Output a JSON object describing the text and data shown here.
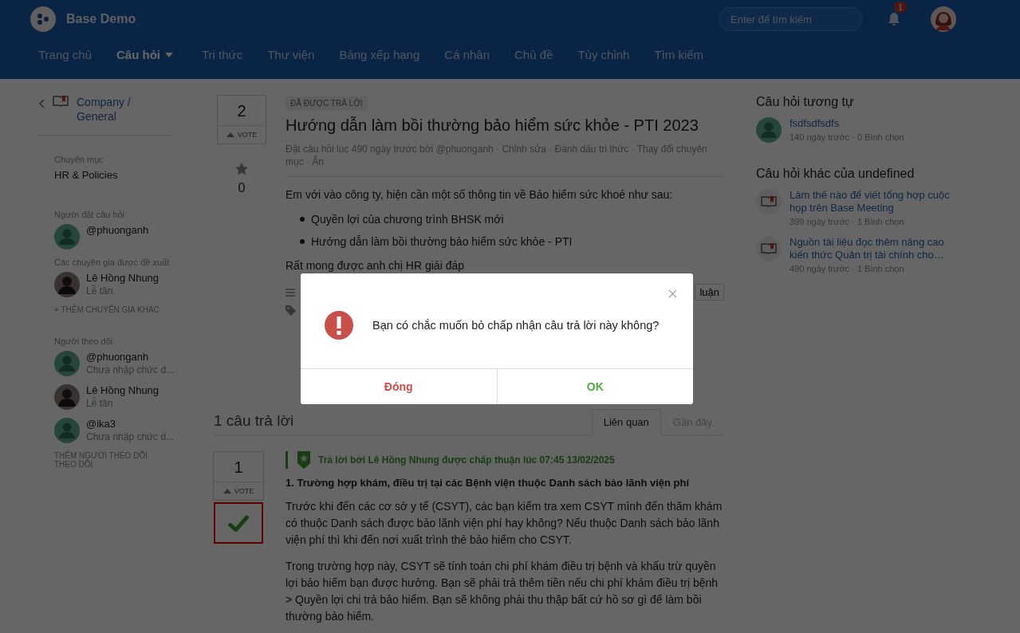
{
  "header": {
    "brand": "Base Demo",
    "search": {
      "placeholder": "Enter để tìm kiếm"
    },
    "notification_count": "1",
    "nav": [
      {
        "label": "Trang chủ",
        "selected": false,
        "dropdown": false
      },
      {
        "label": "Câu hỏi",
        "selected": true,
        "dropdown": true
      },
      {
        "label": "Tri thức",
        "selected": false,
        "dropdown": false
      },
      {
        "label": "Thư viện",
        "selected": false,
        "dropdown": false
      },
      {
        "label": "Bảng xếp hạng",
        "selected": false,
        "dropdown": false
      },
      {
        "label": "Cá nhân",
        "selected": false,
        "dropdown": false
      },
      {
        "label": "Chủ đề",
        "selected": false,
        "dropdown": false
      },
      {
        "label": "Tùy chỉnh",
        "selected": false,
        "dropdown": false
      },
      {
        "label": "Tìm kiếm",
        "selected": false,
        "dropdown": false
      }
    ]
  },
  "sidebar": {
    "breadcrumb": "Company / General",
    "category": {
      "label": "Chuyên mục",
      "value": "HR & Policies"
    },
    "asker": {
      "label": "Người đặt câu hỏi",
      "users": [
        {
          "name": "@phuonganh",
          "kind": "default"
        }
      ]
    },
    "experts": {
      "label": "Các chuyên gia được đề xuất",
      "users": [
        {
          "name": "Lê Hồng Nhung",
          "role": "Lễ tân",
          "kind": "photo"
        }
      ],
      "add_link": "+ THÊM CHUYÊN GIA KHÁC"
    },
    "followers": {
      "label": "Người theo dõi",
      "users": [
        {
          "name": "@phuonganh",
          "role": "Chưa nhập chức d...",
          "kind": "default"
        },
        {
          "name": "Lê Hồng Nhung",
          "role": "Lễ tân",
          "kind": "photo"
        },
        {
          "name": "@ika3",
          "role": "Chưa nhập chức d...",
          "kind": "default"
        }
      ],
      "add_link": "THÊM NGƯỜI THEO DÕI",
      "follow_link": "THEO DÕI"
    }
  },
  "question": {
    "vote_count": "2",
    "vote_label": "VOTE",
    "favorite_count": "0",
    "status": "ĐÃ ĐƯỢC TRẢ LỜI",
    "title": "Hướng dẫn làm bồi thường bảo hiểm sức khỏe - PTI 2023",
    "meta": "Đặt câu hỏi lúc 490 ngày trước bởi @phuonganh · Chỉnh sửa · Đánh dấu tri thức · Thay đổi chuyên mục · Ẩn",
    "intro": "Em với vào công ty, hiện cần một số thông tin về Bảo hiểm sức khoẻ như sau:",
    "bullets": [
      "Quyền lợi của chương trình BHSK mới",
      "Hướng dẫn làm bồi thường bảo hiểm sức khỏe - PTI"
    ],
    "closing": "Rất mong được anh chị HR giải đáp",
    "comment_button": "luận"
  },
  "answers": {
    "heading": "1 câu trả lời",
    "tabs": [
      {
        "label": "Liên quan",
        "selected": true
      },
      {
        "label": "Gần đây",
        "selected": false
      }
    ],
    "items": [
      {
        "vote_count": "1",
        "vote_label": "VOTE",
        "accepted": true,
        "highlighted": true,
        "accepted_text": "Trả lời bởi Lê Hồng Nhung được chấp thuận lúc 07:45 13/02/2025",
        "heading": "1. Trường hợp khám, điều trị tại các Bệnh viện thuộc Danh sách bảo lãnh viện phí",
        "paragraphs": [
          "Trước khi đến các cơ sở y tế (CSYT), các bạn kiểm tra xem CSYT mình đến thăm khám có thuộc Danh sách được bảo lãnh viện phí hay không? Nếu thuộc Danh sách bảo lãnh viện phí thì khi đến nơi xuất trình thẻ bảo hiểm cho CSYT.",
          "Trong trường hợp này, CSYT sẽ tính toán chi phí khám điều trị bệnh và khấu trừ quyền lợi bảo hiểm bạn được hưởng. Bạn sẽ phải trả thêm tiền nếu chi phí khám điều trị bệnh > Quyền lợi chi trả bảo hiểm. Bạn sẽ không phải thu thập bất cứ hồ sơ gì để làm bồi thường bảo hiểm."
        ]
      }
    ]
  },
  "right": {
    "sections": [
      {
        "title": "Câu hỏi tương tự",
        "items": [
          {
            "title": "fsdfsdfsdfs",
            "meta": "140 ngày trước · 0 Bình chọn",
            "kind": "user"
          }
        ]
      },
      {
        "title": "Câu hỏi khác của undefined",
        "items": [
          {
            "title": "Làm thế nào để viết tổng hợp cuộc họp trên Base Meeting",
            "meta": "399 ngày trước · 1 Bình chọn",
            "kind": "book"
          },
          {
            "title": "Nguồn tài liệu đọc thêm nâng cao kiến thức Quản trị tài chính cho…",
            "meta": "490 ngày trước · 1 Bình chọn",
            "kind": "book"
          }
        ]
      }
    ]
  },
  "dialog": {
    "message": "Bạn có chắc muốn bỏ chấp nhận câu trả lời này không?",
    "buttons": [
      {
        "label": "Đóng",
        "kind": "cancel"
      },
      {
        "label": "OK",
        "kind": "confirm"
      }
    ]
  }
}
